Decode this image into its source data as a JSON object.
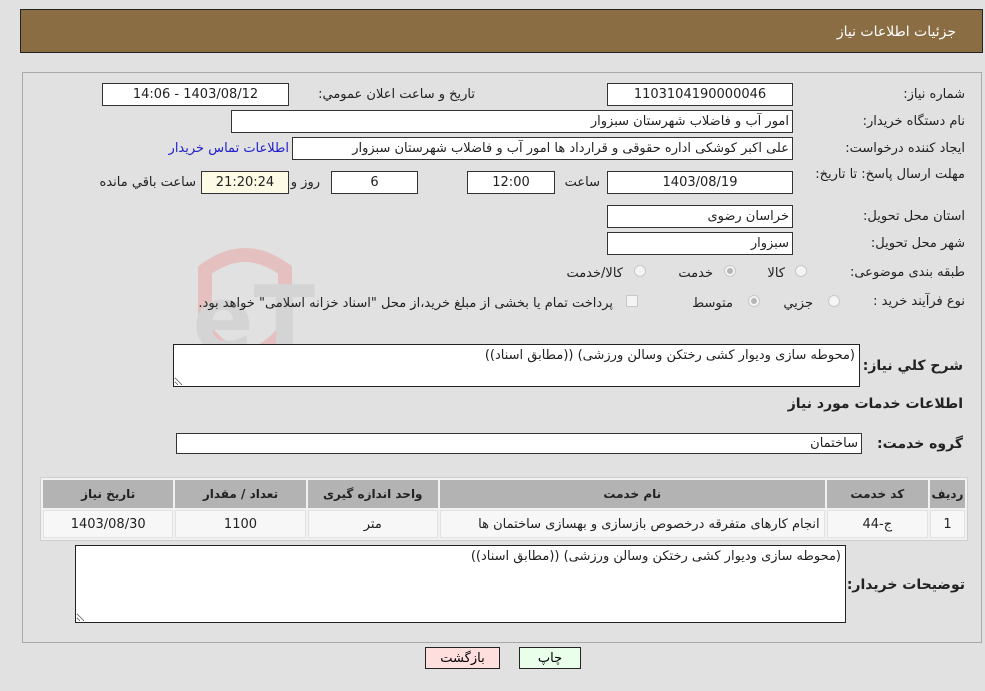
{
  "header": {
    "title": "جزئیات اطلاعات نیاز"
  },
  "form": {
    "need_number": {
      "label": "شماره نیاز:",
      "value": "1103104190000046"
    },
    "announce": {
      "label": "تاریخ و ساعت اعلان عمومي:",
      "value": "1403/08/12 - 14:06"
    },
    "buyer_org": {
      "label": "نام دستگاه خریدار:",
      "value": "امور آب و فاضلاب شهرستان سبزوار"
    },
    "creator": {
      "label": "ایجاد کننده درخواست:",
      "value": "علی اکبر کوشکی اداره حقوقی و قرارداد ها امور آب و فاضلاب شهرستان سبزوار",
      "contact_link": "اطلاعات تماس خریدار"
    },
    "deadline": {
      "label": "مهلت ارسال پاسخ: تا تاریخ:",
      "date": "1403/08/19",
      "time_label": "ساعت",
      "time": "12:00",
      "days": "6",
      "days_label": "روز و",
      "remaining": "21:20:24",
      "remaining_label": "ساعت باقي مانده"
    },
    "province": {
      "label": "استان محل تحویل:",
      "value": "خراسان رضوی"
    },
    "city": {
      "label": "شهر محل تحویل:",
      "value": "سبزوار"
    },
    "category": {
      "label": "طبقه بندی موضوعی:",
      "options": [
        "کالا",
        "خدمت",
        "کالا/خدمت"
      ],
      "selected": "خدمت"
    },
    "purchase_type": {
      "label": "نوع فرآیند خرید :",
      "options": [
        "جزيي",
        "متوسط"
      ],
      "selected": "متوسط",
      "treasury_note": "پرداخت تمام یا بخشی از مبلغ خرید،از محل \"اسناد خزانه اسلامی\" خواهد بود."
    },
    "description": {
      "label": "شرح کلي نياز:",
      "value": "(محوطه سازی ودیوار کشی رختکن وسالن ورزشی) ((مطابق اسناد))"
    },
    "services_title": "اطلاعات خدمات مورد نیاز",
    "service_group": {
      "label": "گروه خدمت:",
      "value": "ساختمان"
    }
  },
  "table": {
    "headers": [
      "ردیف",
      "کد خدمت",
      "نام خدمت",
      "واحد اندازه گیری",
      "تعداد / مقدار",
      "تاریخ نیاز"
    ],
    "rows": [
      [
        "1",
        "ج-44",
        "انجام کارهای متفرقه درخصوص بازسازی و بهسازی ساختمان ها",
        "متر",
        "1100",
        "1403/08/30"
      ]
    ]
  },
  "buyer_notes": {
    "label": "توضیحات خریدار:",
    "value": "(محوطه سازی ودیوار کشی رختکن وسالن ورزشی) ((مطابق اسناد))"
  },
  "buttons": {
    "print": "چاپ",
    "back": "بازگشت"
  },
  "colors": {
    "header_bg": "#8b6d43",
    "print_bg": "#eaffea",
    "back_bg": "#ffdede",
    "link": "#2020cc"
  }
}
